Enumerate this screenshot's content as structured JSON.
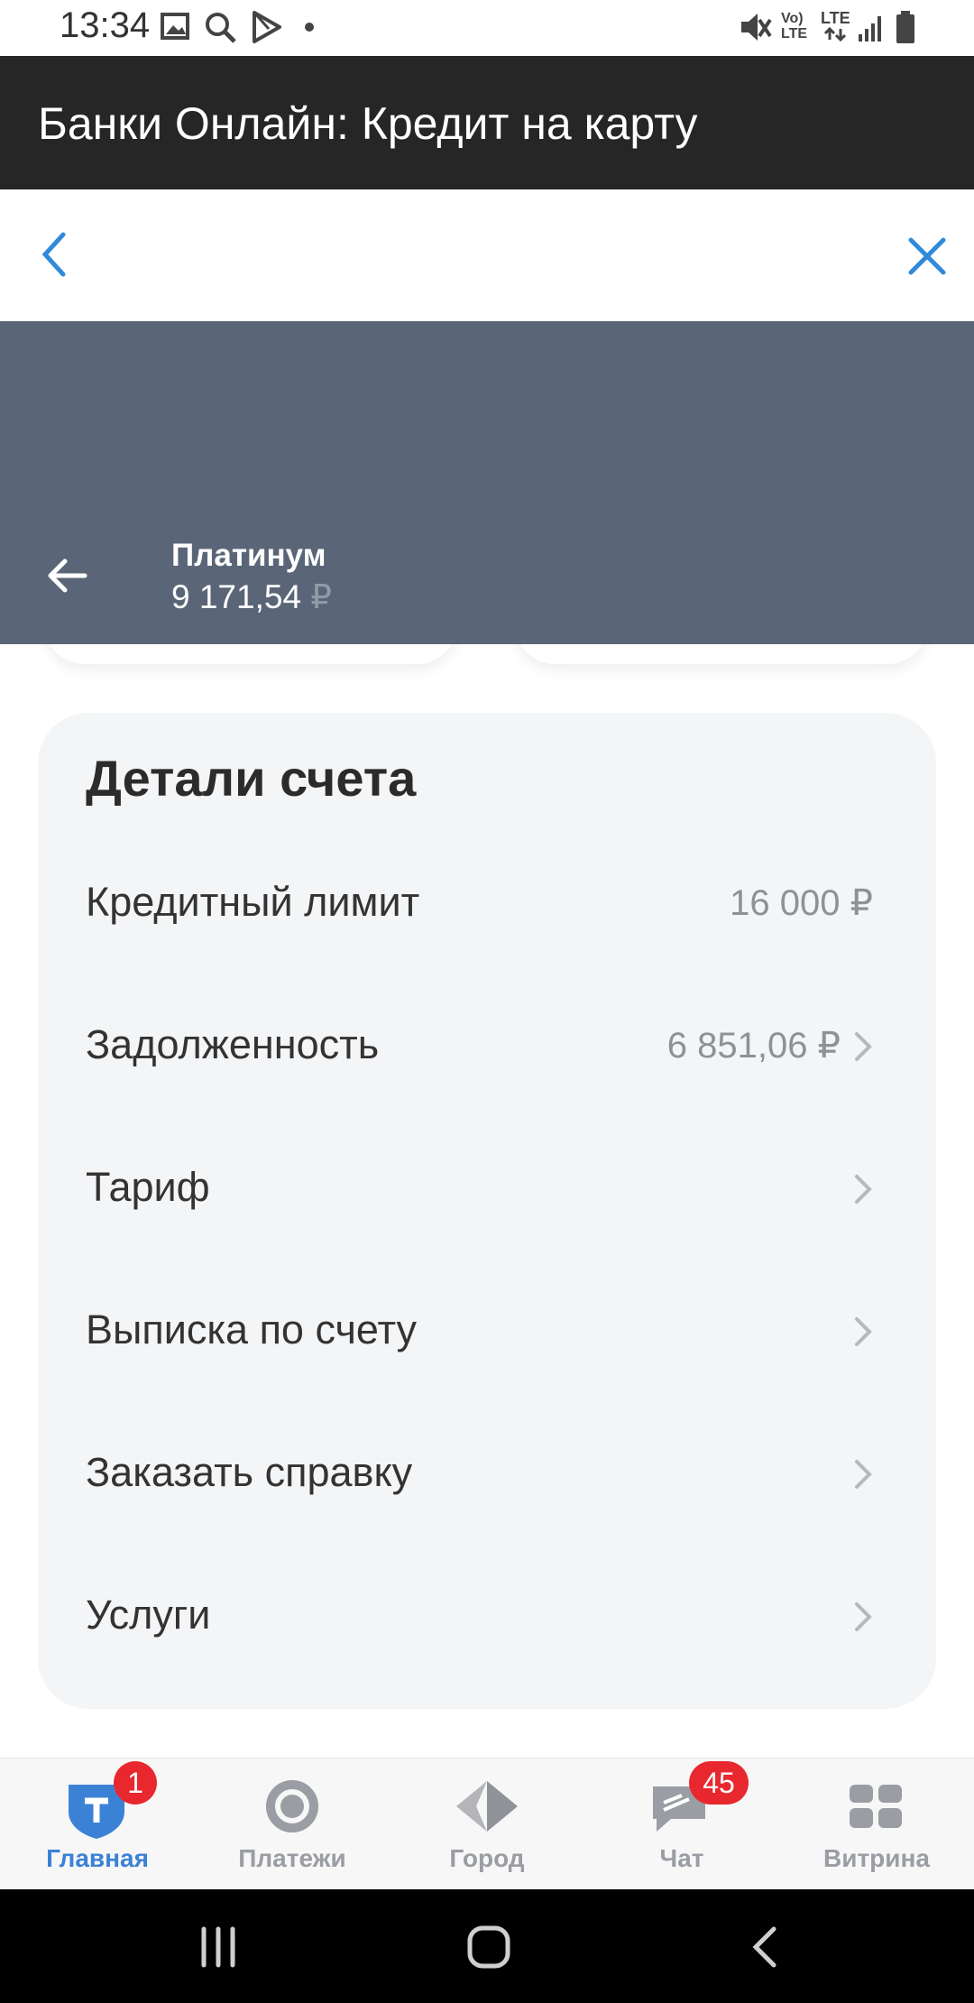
{
  "status_bar": {
    "time": "13:34",
    "net1": "Vo)\nLTE",
    "net2": "LTE"
  },
  "app": {
    "title": "Банки Онлайн: Кредит на карту"
  },
  "account": {
    "name": "Платинум",
    "balance": "9 171,54",
    "currency": "₽"
  },
  "details": {
    "title": "Детали счета",
    "rows": [
      {
        "label": "Кредитный лимит",
        "value": "16 000 ₽"
      },
      {
        "label": "Задолженность",
        "value": "6 851,06 ₽"
      },
      {
        "label": "Тариф",
        "value": ""
      },
      {
        "label": "Выписка по счету",
        "value": ""
      },
      {
        "label": "Заказать справку",
        "value": ""
      },
      {
        "label": "Услуги",
        "value": ""
      }
    ]
  },
  "bottom_nav": {
    "items": [
      {
        "label": "Главная",
        "badge": "1",
        "active": true
      },
      {
        "label": "Платежи"
      },
      {
        "label": "Город"
      },
      {
        "label": "Чат",
        "badge": "45"
      },
      {
        "label": "Витрина"
      }
    ]
  },
  "colors": {
    "accent": "#3b82d6",
    "header": "#5a6677",
    "badge": "#e8282e"
  }
}
